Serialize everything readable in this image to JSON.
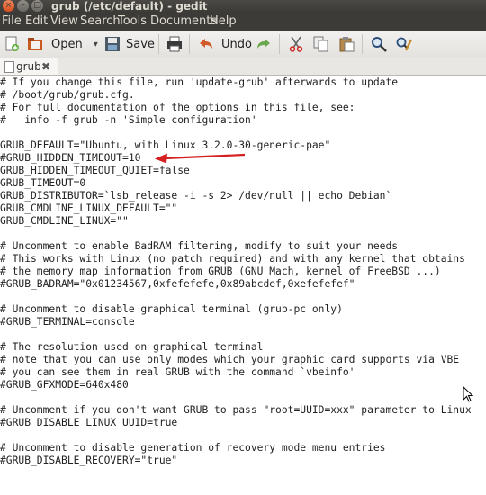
{
  "window": {
    "title": "grub (/etc/default) - gedit",
    "close_glyph": "×",
    "min_glyph": "–",
    "max_glyph": "□"
  },
  "menu": [
    "File",
    "Edit",
    "View",
    "Search",
    "Tools",
    "Documents",
    "Help"
  ],
  "toolbar": {
    "open_label": "Open",
    "save_label": "Save",
    "undo_label": "Undo",
    "dropdown_glyph": "▾"
  },
  "tab": {
    "label": "grub",
    "close_glyph": "✖"
  },
  "editor": {
    "lines": [
      "# If you change this file, run 'update-grub' afterwards to update",
      "# /boot/grub/grub.cfg.",
      "# For full documentation of the options in this file, see:",
      "#   info -f grub -n 'Simple configuration'",
      "",
      "GRUB_DEFAULT=\"Ubuntu, with Linux 3.2.0-30-generic-pae\"",
      "#GRUB_HIDDEN_TIMEOUT=10",
      "GRUB_HIDDEN_TIMEOUT_QUIET=false",
      "GRUB_TIMEOUT=0",
      "GRUB_DISTRIBUTOR=`lsb_release -i -s 2> /dev/null || echo Debian`",
      "GRUB_CMDLINE_LINUX_DEFAULT=\"\"",
      "GRUB_CMDLINE_LINUX=\"\"",
      "",
      "# Uncomment to enable BadRAM filtering, modify to suit your needs",
      "# This works with Linux (no patch required) and with any kernel that obtains",
      "# the memory map information from GRUB (GNU Mach, kernel of FreeBSD ...)",
      "#GRUB_BADRAM=\"0x01234567,0xfefefefe,0x89abcdef,0xefefefef\"",
      "",
      "# Uncomment to disable graphical terminal (grub-pc only)",
      "#GRUB_TERMINAL=console",
      "",
      "# The resolution used on graphical terminal",
      "# note that you can use only modes which your graphic card supports via VBE",
      "# you can see them in real GRUB with the command `vbeinfo'",
      "#GRUB_GFXMODE=640x480",
      "",
      "# Uncomment if you don't want GRUB to pass \"root=UUID=xxx\" parameter to Linux",
      "#GRUB_DISABLE_LINUX_UUID=true",
      "",
      "# Uncomment to disable generation of recovery mode menu entries",
      "#GRUB_DISABLE_RECOVERY=\"true\""
    ],
    "annotation_arrow_color": "#d42020"
  }
}
